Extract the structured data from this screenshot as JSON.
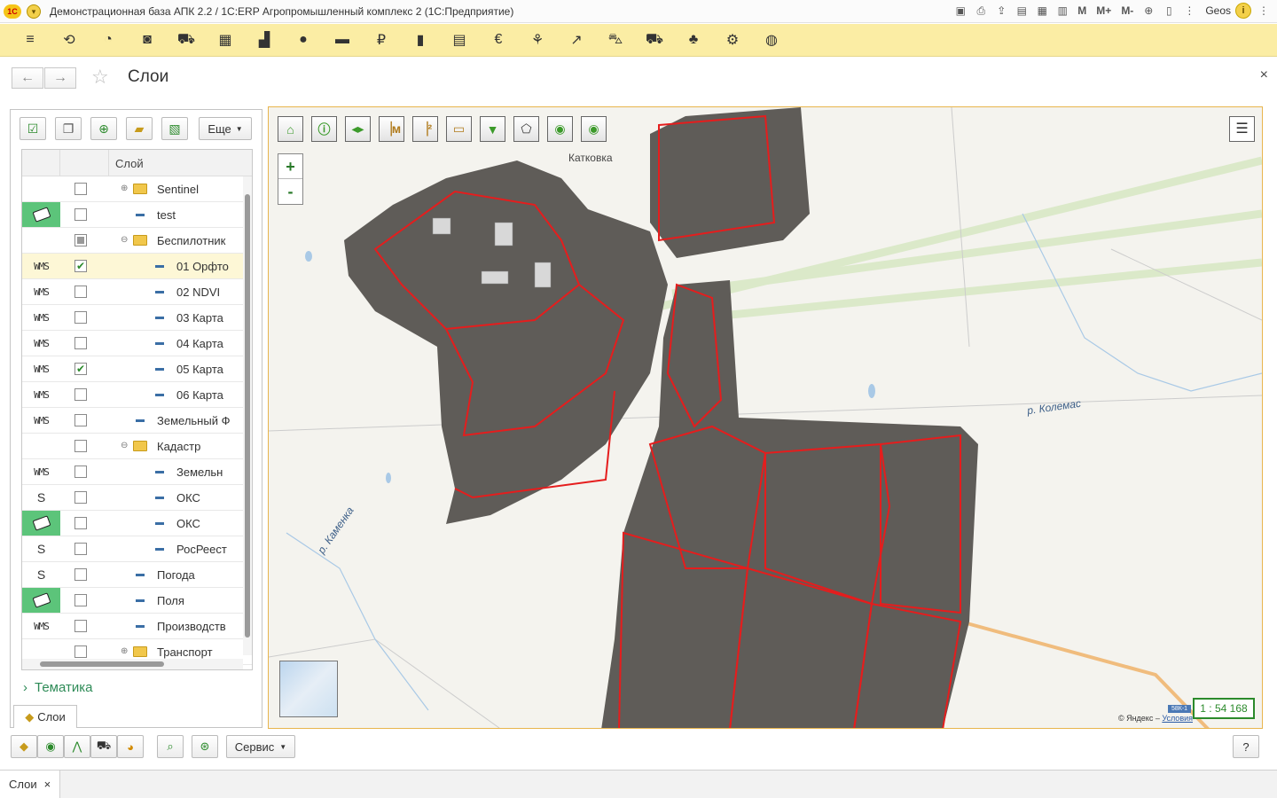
{
  "window": {
    "title": "Демонстрационная база АПК 2.2 / 1С:ERP Агропромышленный комплекс 2   (1С:Предприятие)",
    "logo": "1С",
    "user": "Geos",
    "m_labels": [
      "M",
      "M+",
      "M-"
    ]
  },
  "sections": [
    "menu-icon",
    "history-icon",
    "pie-icon",
    "bag-icon",
    "cart-icon",
    "grid-icon",
    "factory-icon",
    "person-icon",
    "card-icon",
    "ruble-icon",
    "bars-icon",
    "calculator-icon",
    "euro-icon",
    "wheat-icon",
    "chart-up-icon",
    "tractor-icon",
    "truck-icon",
    "sprout-icon",
    "gear-icon",
    "globe-icon"
  ],
  "page": {
    "title": "Слои",
    "back": "←",
    "forward": "→",
    "close": "×"
  },
  "left_panel": {
    "more_label": "Еще",
    "column_header": "Слой",
    "rows": [
      {
        "type": "",
        "checked": false,
        "label": "Sentinel",
        "kind": "folder",
        "level": 0,
        "expander": "⊕"
      },
      {
        "type": "tag",
        "checked": false,
        "label": "test",
        "kind": "item",
        "level": 0
      },
      {
        "type": "",
        "checked": "partial",
        "label": "Беспилотник",
        "kind": "folder",
        "level": 0,
        "expander": "⊖"
      },
      {
        "type": "WMS",
        "checked": true,
        "label": "01 Орфто",
        "kind": "item",
        "level": 1
      },
      {
        "type": "WMS",
        "checked": false,
        "label": "02 NDVI",
        "kind": "item",
        "level": 1
      },
      {
        "type": "WMS",
        "checked": false,
        "label": "03 Карта",
        "kind": "item",
        "level": 1
      },
      {
        "type": "WMS",
        "checked": false,
        "label": "04 Карта",
        "kind": "item",
        "level": 1
      },
      {
        "type": "WMS",
        "checked": true,
        "label": "05 Карта",
        "kind": "item",
        "level": 1
      },
      {
        "type": "WMS",
        "checked": false,
        "label": "06 Карта",
        "kind": "item",
        "level": 1
      },
      {
        "type": "WMS",
        "checked": false,
        "label": "Земельный Ф",
        "kind": "item",
        "level": 0
      },
      {
        "type": "",
        "checked": false,
        "label": "Кадастр",
        "kind": "folder",
        "level": 0,
        "expander": "⊖"
      },
      {
        "type": "WMS",
        "checked": false,
        "label": "Земельн",
        "kind": "item",
        "level": 1
      },
      {
        "type": "S",
        "checked": false,
        "label": "ОКС",
        "kind": "item",
        "level": 1
      },
      {
        "type": "tag",
        "checked": false,
        "label": "ОКС",
        "kind": "item",
        "level": 1
      },
      {
        "type": "S",
        "checked": false,
        "label": "РосРеест",
        "kind": "item",
        "level": 1
      },
      {
        "type": "S",
        "checked": false,
        "label": "Погода",
        "kind": "item",
        "level": 0
      },
      {
        "type": "tag",
        "checked": false,
        "label": "Поля",
        "kind": "item",
        "level": 0
      },
      {
        "type": "WMS",
        "checked": false,
        "label": "Производств",
        "kind": "item",
        "level": 0
      },
      {
        "type": "",
        "checked": false,
        "label": "Транспорт",
        "kind": "folder",
        "level": 0,
        "expander": "⊕"
      }
    ],
    "thematics_label": "Тематика",
    "tab_label": "Слои"
  },
  "map": {
    "labels": {
      "village": "Катковка",
      "river1": "р. Колемас",
      "river2": "р. Каменка"
    },
    "scale": "1 : 54 168",
    "copyright": "© Яндекс – ",
    "terms": "Условия",
    "chip": "58К-1",
    "zoom_in": "+",
    "zoom_out": "-"
  },
  "bottom": {
    "service_label": "Сервис",
    "help_label": "?"
  },
  "tabs": {
    "open_tab": "Слои",
    "close": "×"
  }
}
